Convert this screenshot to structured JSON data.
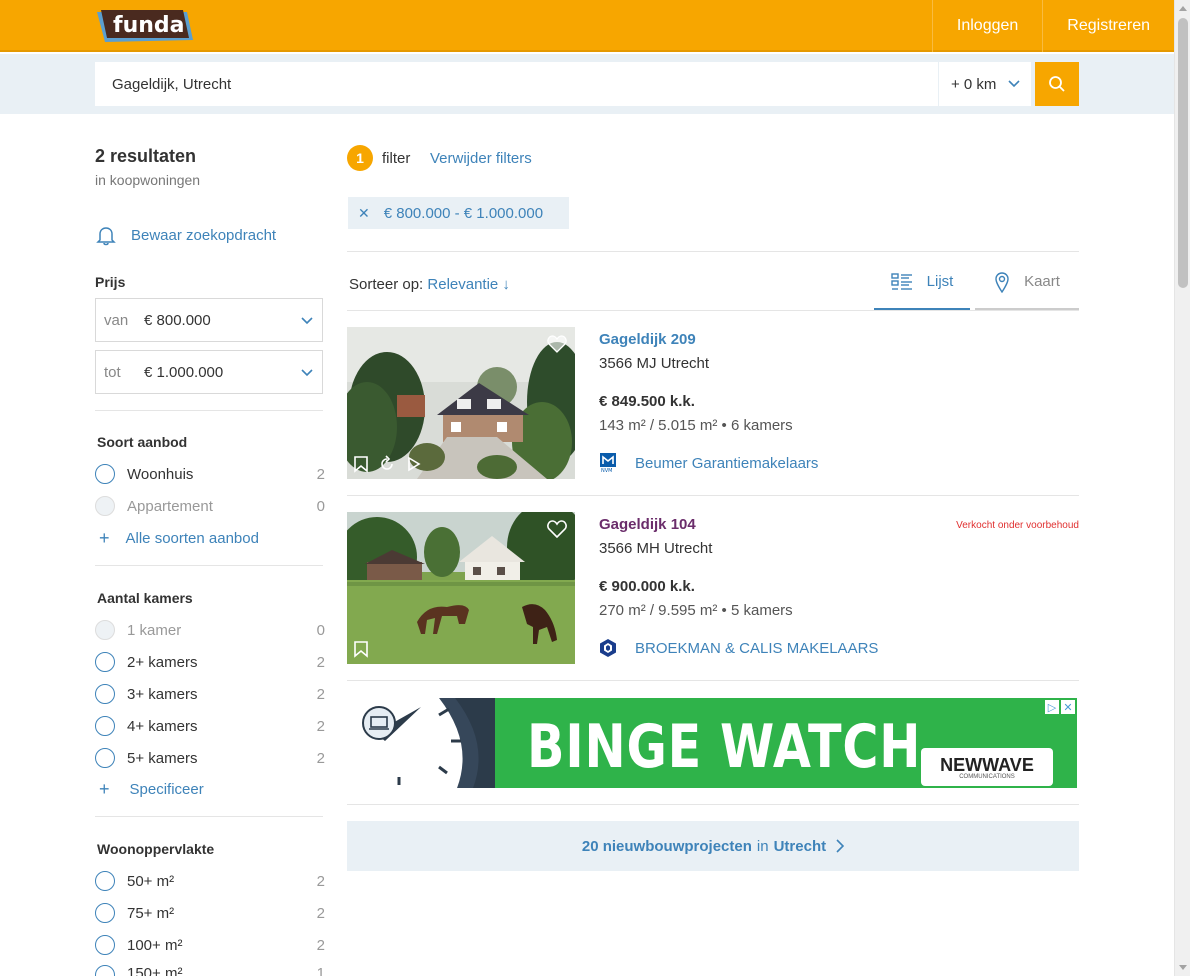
{
  "header": {
    "logo_text": "funda",
    "login_label": "Inloggen",
    "register_label": "Registreren"
  },
  "search": {
    "value": "Gageldijk, Utrecht",
    "radius": "+ 0 km"
  },
  "sidebar": {
    "result_count": "2 resultaten",
    "result_sub": "in koopwoningen",
    "save_search": "Bewaar zoekopdracht",
    "price": {
      "title": "Prijs",
      "from_label": "van",
      "from_value": "€ 800.000",
      "to_label": "tot",
      "to_value": "€ 1.000.000"
    },
    "offer_type": {
      "title": "Soort aanbod",
      "options": [
        {
          "label": "Woonhuis",
          "count": "2"
        },
        {
          "label": "Appartement",
          "count": "0"
        }
      ],
      "more_link": "Alle soorten aanbod"
    },
    "rooms": {
      "title": "Aantal kamers",
      "options": [
        {
          "label": "1 kamer",
          "count": "0"
        },
        {
          "label": "2+ kamers",
          "count": "2"
        },
        {
          "label": "3+ kamers",
          "count": "2"
        },
        {
          "label": "4+ kamers",
          "count": "2"
        },
        {
          "label": "5+ kamers",
          "count": "2"
        }
      ],
      "more_link": "Specificeer"
    },
    "area": {
      "title": "Woonoppervlakte",
      "options": [
        {
          "label": "50+ m²",
          "count": "2"
        },
        {
          "label": "75+ m²",
          "count": "2"
        },
        {
          "label": "100+ m²",
          "count": "2"
        },
        {
          "label": "150+ m²",
          "count": "1"
        }
      ]
    }
  },
  "filters": {
    "count": "1",
    "label": "filter",
    "remove_label": "Verwijder filters",
    "chip": "€ 800.000 - € 1.000.000"
  },
  "sort": {
    "label": "Sorteer op:",
    "value": "Relevantie ↓"
  },
  "views": {
    "list": "Lijst",
    "map": "Kaart"
  },
  "listings": [
    {
      "address": "Gageldijk 209",
      "zip": "3566 MJ Utrecht",
      "price": "€ 849.500 k.k.",
      "specs": "143 m² / 5.015 m² • 6 kamers",
      "agent": "Beumer Garantiemakelaars",
      "status": "",
      "address_color": "#3e83b9"
    },
    {
      "address": "Gageldijk 104",
      "zip": "3566 MH Utrecht",
      "price": "€ 900.000 k.k.",
      "specs": "270 m² / 9.595 m² • 5 kamers",
      "agent": "BROEKMAN & CALIS MAKELAARS",
      "status": "Verkocht onder voorbehoud",
      "address_color": "#6b2d6b"
    }
  ],
  "ad": {
    "headline": "BINGE WATCH",
    "brand": "NEWWAVE",
    "brand_sub": "COMMUNICATIONS"
  },
  "newbuild": {
    "count_text": "20 nieuwbouwprojecten",
    "in_text": "in",
    "city": "Utrecht"
  },
  "colors": {
    "brand_orange": "#f7a600",
    "link_blue": "#3e83b9",
    "sold_red": "#e03030"
  }
}
